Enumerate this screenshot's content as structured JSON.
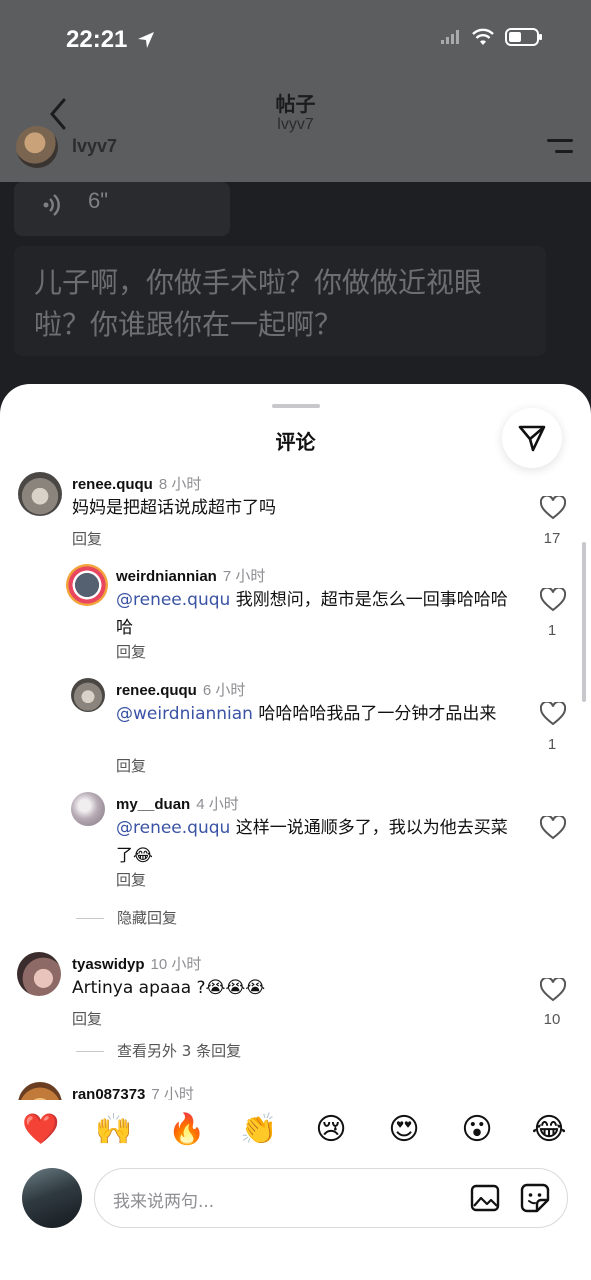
{
  "status_bar": {
    "time": "22:21"
  },
  "header": {
    "title": "帖子",
    "subtitle": "lvyv7",
    "author": "lvyv7"
  },
  "post": {
    "audio_length": "6\"",
    "transcript": "儿子啊，你做手术啦？你做做近视眼啦？你谁跟你在一起啊？"
  },
  "sheet": {
    "title": "评论"
  },
  "comments": [
    {
      "user": "renee.ququ",
      "time": "8 小时",
      "mention": "",
      "text": "妈妈是把超话说成超市了吗",
      "reply_label": "回复",
      "likes": "17"
    },
    {
      "user": "weirdniannian",
      "time": "7 小时",
      "mention": "@renee.ququ",
      "text": " 我刚想问，超市是怎么一回事哈哈哈哈",
      "reply_label": "回复",
      "likes": "1"
    },
    {
      "user": "renee.ququ",
      "time": "6 小时",
      "mention": "@weirdniannian",
      "text": " 哈哈哈哈我品了一分钟才品出来",
      "reply_label": "回复",
      "likes": "1"
    },
    {
      "user": "my__duan",
      "time": "4 小时",
      "mention": "@renee.ququ",
      "text": " 这样一说通顺多了，我以为他去买菜了😂",
      "reply_label": "回复",
      "likes": ""
    },
    {
      "user": "tyaswidyp",
      "time": "10 小时",
      "mention": "",
      "text": "Artinya apaaa ?😭😭😭",
      "reply_label": "回复",
      "likes": "10"
    },
    {
      "user": "ran087373",
      "time": "7 小时"
    }
  ],
  "threads": {
    "hide_replies": "隐藏回复",
    "view_more": "查看另外 3 条回复"
  },
  "emoji_bar": [
    "❤️",
    "🙌",
    "🔥",
    "👏",
    "😢",
    "😍",
    "😮",
    "😂"
  ],
  "composer": {
    "placeholder": "我来说两句..."
  }
}
